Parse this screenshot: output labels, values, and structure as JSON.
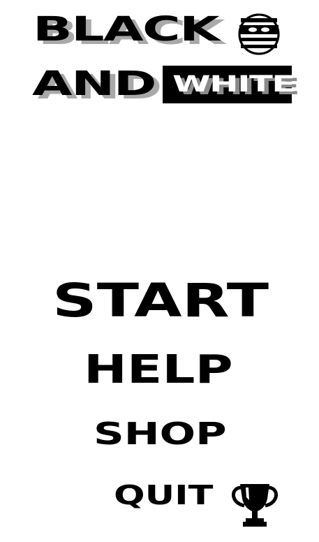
{
  "logo": {
    "line1": "BLACK",
    "line2": "AND",
    "line3": "WHITE",
    "mascot_icon": "masked-face-icon"
  },
  "menu": {
    "start_label": "START",
    "help_label": "HELP",
    "shop_label": "SHOP",
    "quit_label": "QUIT"
  },
  "icons": {
    "trophy": "trophy-icon"
  },
  "colors": {
    "background": "#ffffff",
    "foreground": "#000000",
    "shadow": "#a9a9a9"
  }
}
